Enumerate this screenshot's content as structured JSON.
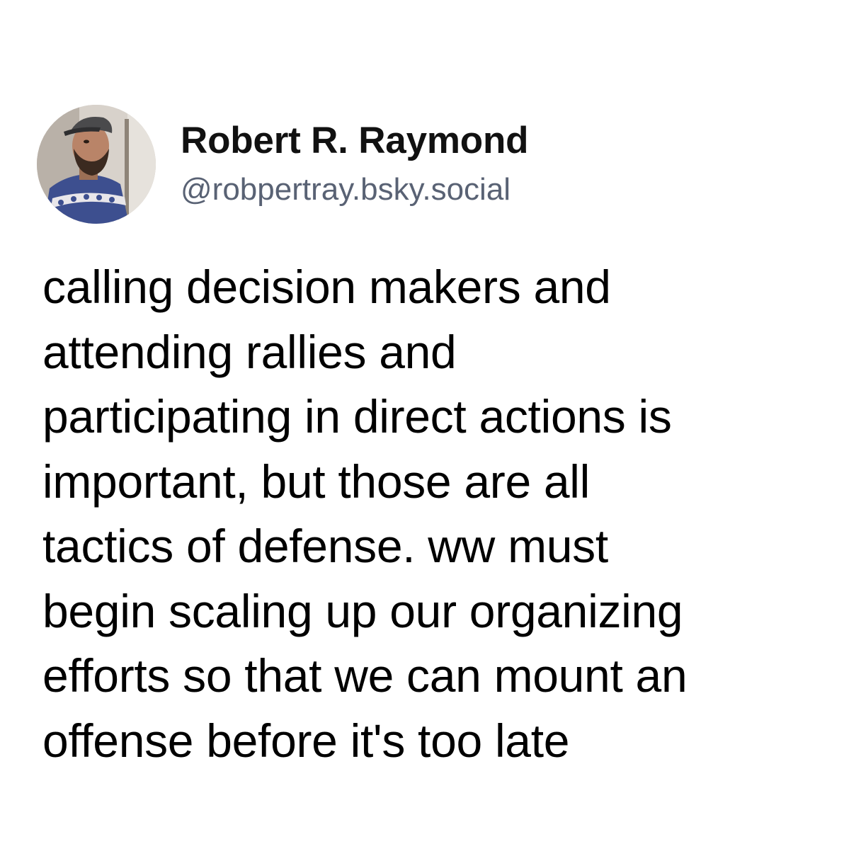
{
  "post": {
    "author_name": "Robert R. Raymond",
    "author_handle": "@robpertray.bsky.social",
    "text_lines": [
      "calling decision makers and",
      "attending rallies and",
      "participating in direct actions is",
      "important, but those are all",
      "tactics of defense. ww must",
      "begin scaling up our organizing",
      "efforts so that we can mount an",
      "offense before it's too late"
    ]
  },
  "colors": {
    "background": "#ffffff",
    "name": "#111111",
    "handle": "#596274",
    "body_text": "#000000"
  }
}
